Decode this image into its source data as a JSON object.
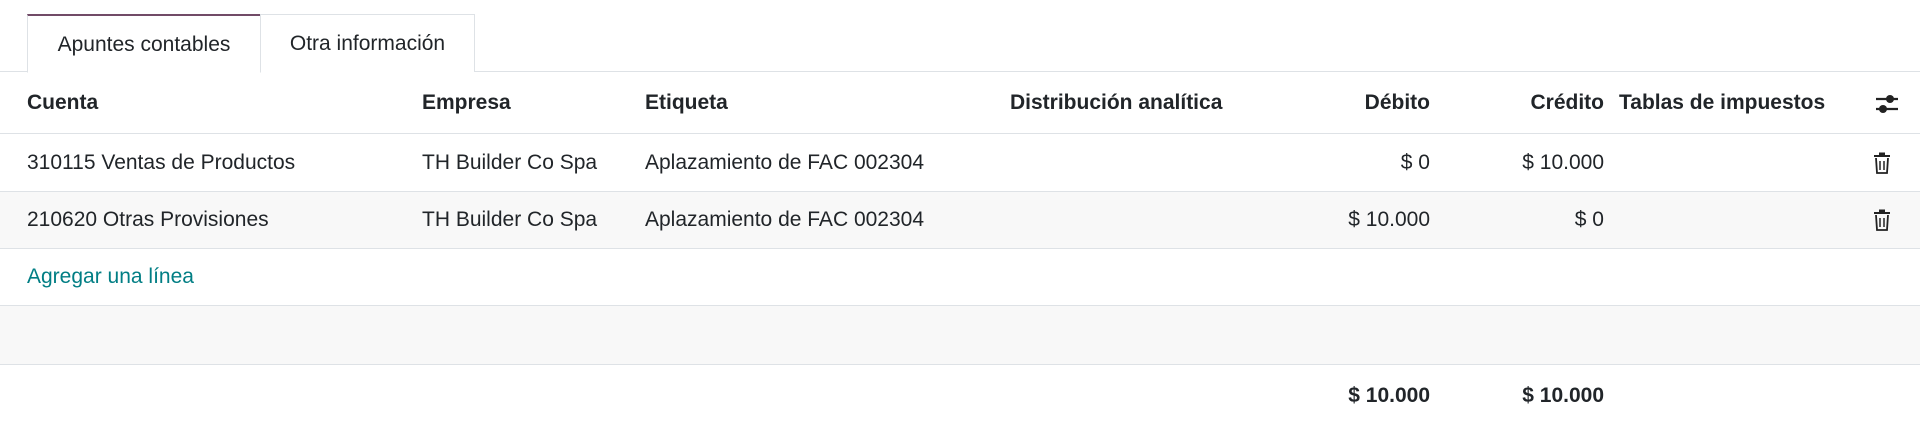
{
  "tabs": [
    {
      "label": "Apuntes contables",
      "active": true
    },
    {
      "label": "Otra información",
      "active": false
    }
  ],
  "table": {
    "headers": {
      "account": "Cuenta",
      "partner": "Empresa",
      "label": "Etiqueta",
      "analytic": "Distribución analítica",
      "debit": "Débito",
      "credit": "Crédito",
      "taxes": "Tablas de impuestos"
    },
    "rows": [
      {
        "account": "310115 Ventas de Productos",
        "partner": "TH Builder Co Spa",
        "label": "Aplazamiento de FAC 002304",
        "analytic": "",
        "debit": "$ 0",
        "credit": "$ 10.000",
        "taxes": ""
      },
      {
        "account": "210620 Otras Provisiones",
        "partner": "TH Builder Co Spa",
        "label": "Aplazamiento de FAC 002304",
        "analytic": "",
        "debit": "$ 10.000",
        "credit": "$ 0",
        "taxes": ""
      }
    ],
    "add_line": "Agregar una línea",
    "totals": {
      "debit": "$ 10.000",
      "credit": "$ 10.000"
    }
  },
  "icons": {
    "optional_columns": "sliders-icon",
    "delete": "trash-icon"
  },
  "colors": {
    "link": "#017e84",
    "tab_accent": "#714b67",
    "border": "#dee2e6",
    "stripe": "#f8f8f8"
  }
}
